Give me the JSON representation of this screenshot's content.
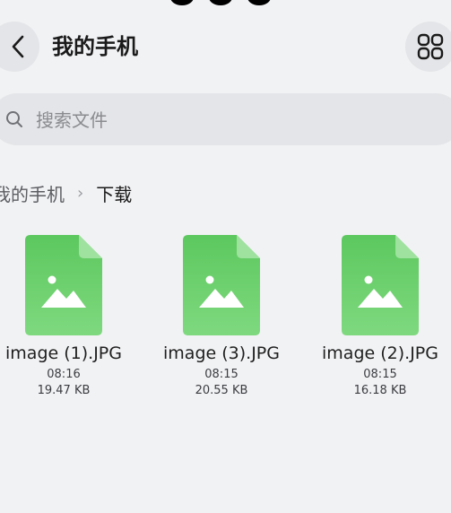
{
  "header": {
    "title": "我的手机"
  },
  "search": {
    "placeholder": "搜索文件"
  },
  "breadcrumb": {
    "root": "我的手机",
    "separator": "›",
    "current": "下载"
  },
  "files": [
    {
      "name": "image (1).JPG",
      "time": "08:16",
      "size": "19.47 KB",
      "icon": "image-file-icon"
    },
    {
      "name": "image (3).JPG",
      "time": "08:15",
      "size": "20.55 KB",
      "icon": "image-file-icon"
    },
    {
      "name": "image (2).JPG",
      "time": "08:15",
      "size": "16.18 KB",
      "icon": "image-file-icon"
    }
  ],
  "colors": {
    "file_icon_top": "#5cc85e",
    "file_icon_bottom": "#7fd97f",
    "background": "#f1f2f4"
  }
}
